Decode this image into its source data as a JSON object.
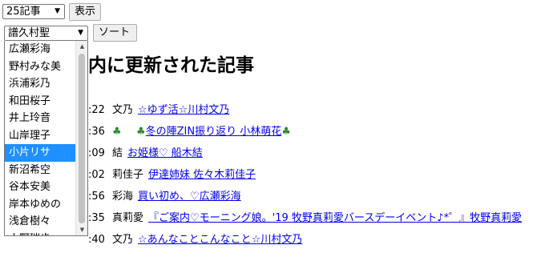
{
  "toolbar": {
    "count_select_value": "25記事",
    "show_button": "表示",
    "member_select_value": "譜久村聖",
    "sort_button": "ソート"
  },
  "dropdown": {
    "items": [
      "広瀬彩海",
      "野村みな美",
      "浜浦彩乃",
      "和田桜子",
      "井上玲音",
      "山岸理子",
      "小片リサ",
      "新沼希空",
      "谷本安美",
      "岸本ゆめの",
      "浅倉樹々",
      "小野瑞歩"
    ],
    "selected": "小片リサ"
  },
  "heading": "内に更新された記事",
  "rows": [
    {
      "time": ":22",
      "author": "文乃",
      "icon": "",
      "title": "☆ゆず活☆川村文乃"
    },
    {
      "time": ":36",
      "author": "",
      "icon": "clover-icon",
      "title": "冬の陣ZIN振り返り 小林萌花"
    },
    {
      "time": ":09",
      "author": "結",
      "icon": "",
      "title": "お姫様♡ 船木結"
    },
    {
      "time": ":02",
      "author": "莉佳子",
      "icon": "",
      "title": "伊達姉妹 佐々木莉佳子"
    },
    {
      "time": ":56",
      "author": "彩海",
      "icon": "",
      "title": "買い初め、♡広瀬彩海"
    },
    {
      "time": ":35",
      "author": "真莉愛",
      "icon": "",
      "title": "『ご案内♡モーニング娘。'19 牧野真莉愛バースデーイベント♪*゜』牧野真莉愛"
    },
    {
      "time": ":40",
      "author": "文乃",
      "icon": "",
      "title": "☆あんなことこんなこと☆川村文乃"
    }
  ]
}
